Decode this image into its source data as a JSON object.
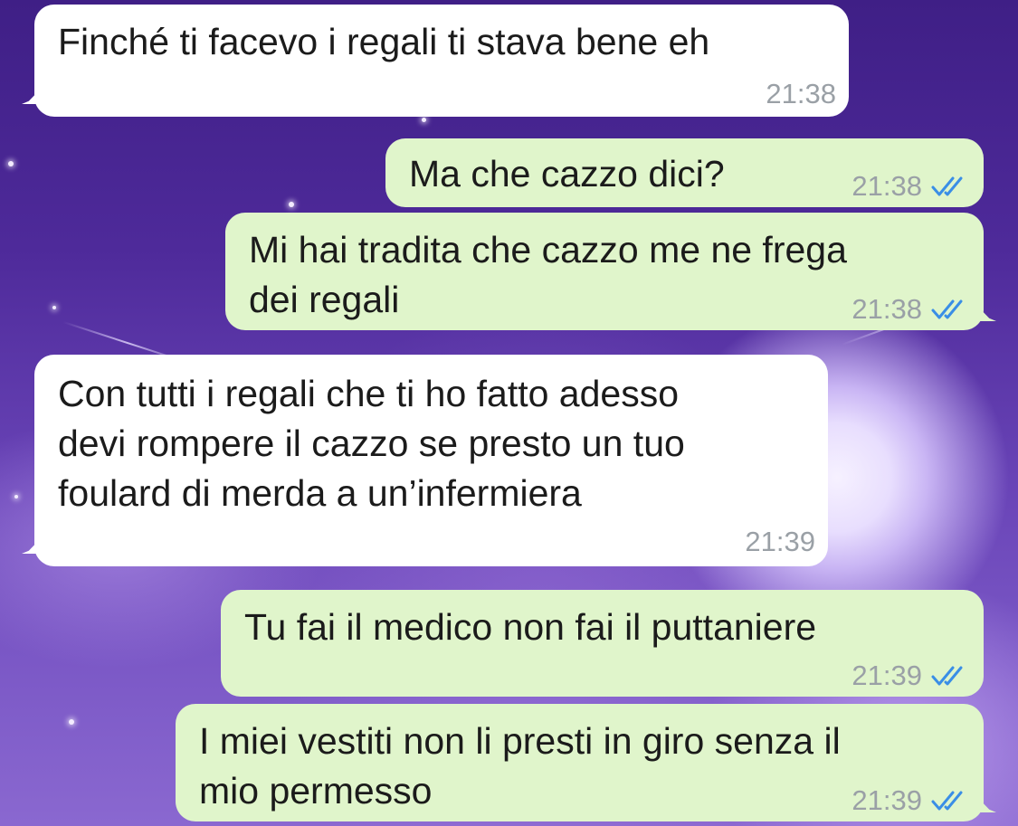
{
  "colors": {
    "incoming_bubble": "#ffffff",
    "outgoing_bubble": "#e0f5cb",
    "timestamp": "#9aa0a6",
    "read_ticks": "#3a8ee6"
  },
  "messages": [
    {
      "direction": "incoming",
      "text": "Finché ti facevo i regali ti stava bene eh",
      "time": "21:38"
    },
    {
      "direction": "outgoing",
      "text": "Ma che cazzo dici?",
      "time": "21:38",
      "status_icon": "double-check-read-icon"
    },
    {
      "direction": "outgoing",
      "text": "Mi hai tradita che cazzo me ne frega\ndei regali",
      "time": "21:38",
      "status_icon": "double-check-read-icon"
    },
    {
      "direction": "incoming",
      "text": "Con tutti i regali che ti ho fatto adesso\ndevi rompere il cazzo se presto un tuo\nfoulard di merda a un’infermiera",
      "time": "21:39"
    },
    {
      "direction": "outgoing",
      "text": "Tu fai il medico non fai il puttaniere",
      "time": "21:39",
      "status_icon": "double-check-read-icon"
    },
    {
      "direction": "outgoing",
      "text": "I miei vestiti non li presti in giro senza il\nmio permesso",
      "time": "21:39",
      "status_icon": "double-check-read-icon"
    }
  ]
}
